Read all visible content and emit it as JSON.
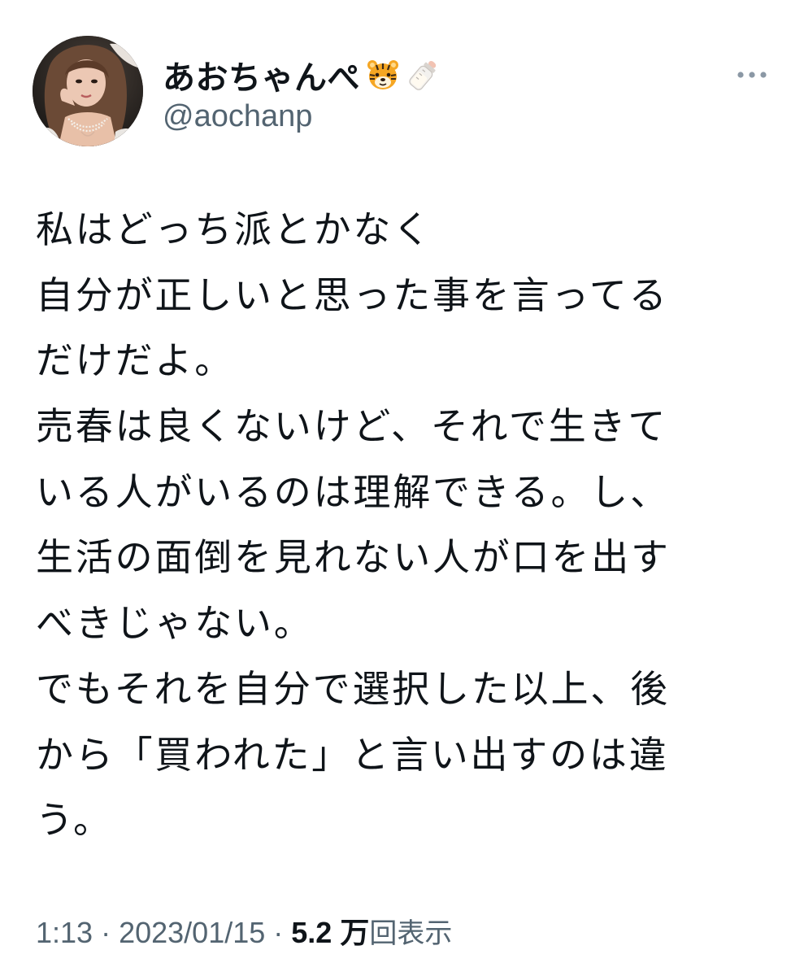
{
  "author": {
    "display_name": "あおちゃんぺ",
    "handle": "@aochanp",
    "name_emojis": [
      "tiger-face-icon",
      "baby-bottle-icon"
    ]
  },
  "more_menu": {
    "icon": "more-horizontal-icon"
  },
  "tweet": {
    "lines": [
      "私はどっち派とかなく",
      "自分が正しいと思った事を言ってる",
      "だけだよ。",
      "売春は良くないけど、それで生きて",
      "いる人がいるのは理解できる。し、",
      "生活の面倒を見れない人が口を出す",
      "べきじゃない。",
      "でもそれを自分で選択した以上、後",
      "から「買われた」と言い出すのは違",
      "う。"
    ]
  },
  "meta": {
    "time": "1:13",
    "separator": "·",
    "date": "2023/01/15",
    "views_count": "5.2 万",
    "views_label": "回表示"
  },
  "colors": {
    "text_primary": "#0f1419",
    "text_secondary": "#536471",
    "background": "#ffffff"
  }
}
